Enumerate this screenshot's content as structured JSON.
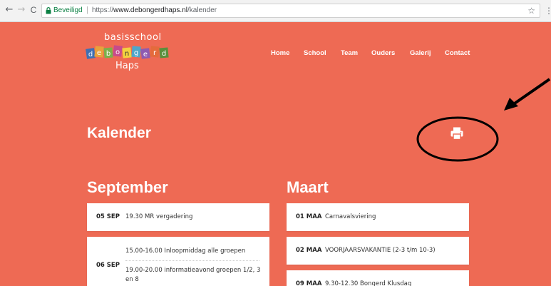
{
  "browser": {
    "back_glyph": "←",
    "forward_glyph": "→",
    "reload_glyph": "C",
    "secure_label": "Beveiligd",
    "url_prefix": "https://",
    "url_host": "www.debongerdhaps.nl",
    "url_path": "/kalender",
    "star_glyph": "☆",
    "menu_glyph": "⋮"
  },
  "site": {
    "logo_top": "basisschool",
    "logo_letters": [
      "d",
      "e",
      "b",
      "o",
      "n",
      "g",
      "e",
      "r",
      "d"
    ],
    "logo_bottom": "Haps",
    "nav": [
      "Home",
      "School",
      "Team",
      "Ouders",
      "Galerij",
      "Contact"
    ],
    "accent_color": "#ee6a54"
  },
  "page": {
    "title": "Kalender",
    "print_icon": "printer-icon"
  },
  "calendar": {
    "col1_month": "September",
    "col2_month": "Maart",
    "sep_ev1_date": "05 SEP",
    "sep_ev1_text": "19.30 MR vergadering",
    "sep_ev2_date": "06 SEP",
    "sep_ev2_text_a": "15.00-16.00 Inloopmiddag alle groepen",
    "sep_ev2_text_b": "19.00-20.00 informatieavond groepen 1/2, 3 en 8",
    "mrt_ev1_date": "01 MAA",
    "mrt_ev1_text": "Carnavalsviering",
    "mrt_ev2_date": "02 MAA",
    "mrt_ev2_text": "VOORJAARSVAKANTIE (2-3 t/m 10-3)",
    "mrt_ev3_date": "09 MAA",
    "mrt_ev3_text": "9.30-12.30 Bongerd Klusdag"
  }
}
